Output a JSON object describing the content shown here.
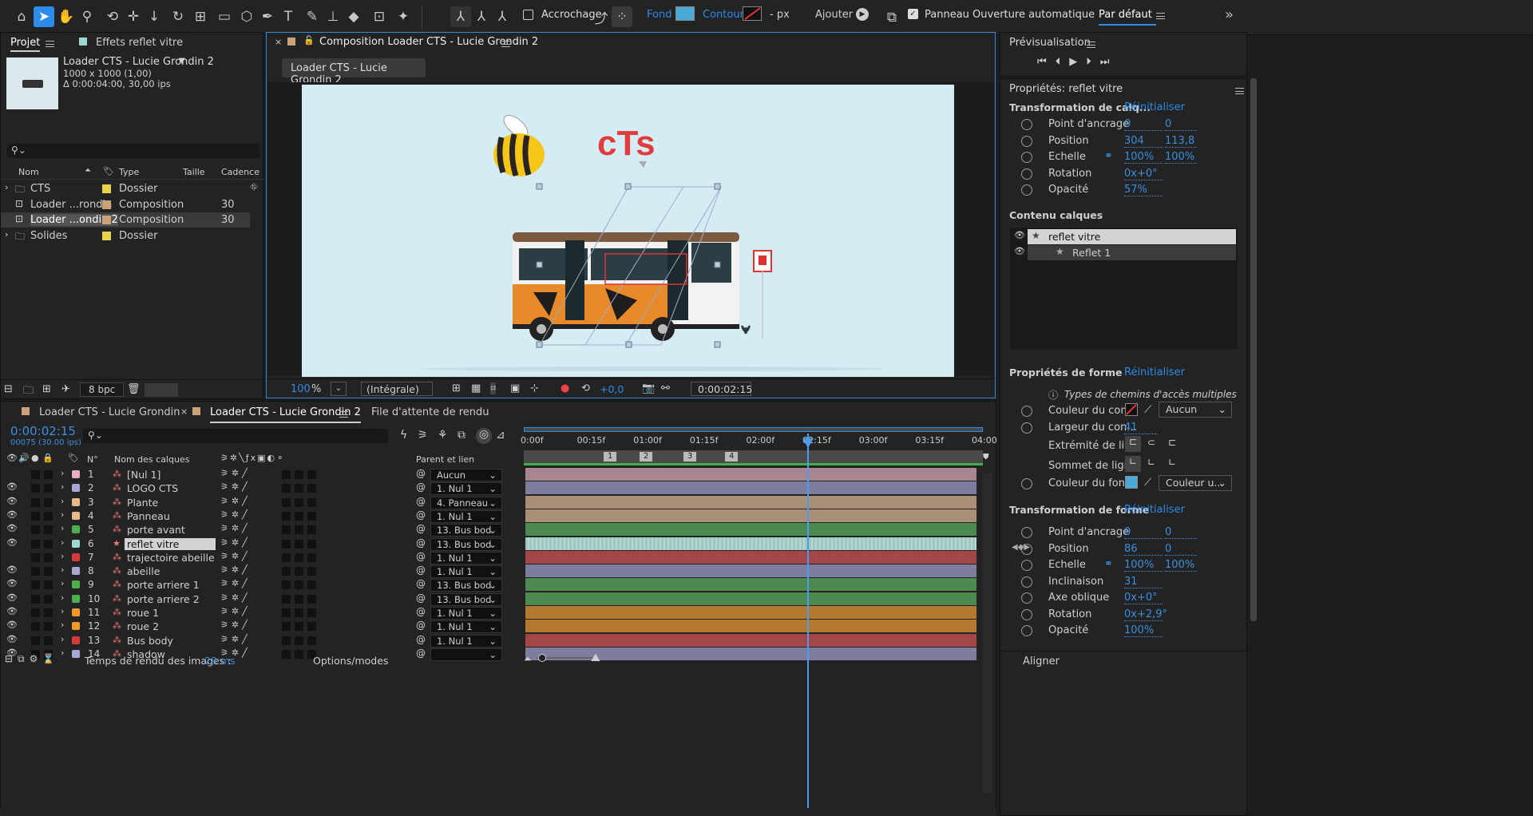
{
  "toolbar": {
    "snap_label": "Accrochage",
    "fill_label": "Fond :",
    "stroke_label": "Contour :",
    "stroke_unit": "- px",
    "add_label": "Ajouter :",
    "auto_open_label": "Panneau Ouverture automatique",
    "workspace": "Par défaut"
  },
  "project": {
    "tab_label": "Projet",
    "effects_tab": "Effets reflet vitre",
    "comp_name": "Loader CTS - Lucie Grondin 2",
    "comp_size": "1000 x 1000 (1,00)",
    "comp_duration": "Δ 0:00:04:00, 30,00 ips",
    "search_placeholder": "",
    "columns": [
      "Nom",
      "Type",
      "Taille",
      "Cadence"
    ],
    "items": [
      {
        "name": "CTS",
        "type": "Dossier",
        "cadence": "",
        "color": "#e8d34c"
      },
      {
        "name": "Loader ...rondin",
        "type": "Composition",
        "cadence": "30",
        "color": "#c9a27a"
      },
      {
        "name": "Loader ...ondin 2",
        "type": "Composition",
        "cadence": "30",
        "color": "#c9a27a"
      },
      {
        "name": "Solides",
        "type": "Dossier",
        "cadence": "",
        "color": "#e8d34c"
      }
    ],
    "bpc": "8 bpc"
  },
  "composition": {
    "tab_title": "Composition Loader CTS - Lucie Grondin 2",
    "sub_tab": "Loader CTS - Lucie Grondin 2",
    "logo_text": "cTs",
    "zoom": "100",
    "zoom_unit": "%",
    "resolution": "(Intégrale)",
    "exposure": "+0,0",
    "timecode": "0:00:02:15"
  },
  "timeline": {
    "tabs": [
      "Loader CTS - Lucie Grondin",
      "Loader CTS - Lucie Grondin 2",
      "File d'attente de rendu"
    ],
    "timecode": "0:00:02:15",
    "fps_info": "00075 (30.00 ips)",
    "col_num": "N°",
    "col_name": "Nom des calques",
    "col_parent": "Parent et lien",
    "ruler": [
      "0:00f",
      "00:15f",
      "01:00f",
      "01:15f",
      "02:00f",
      "02:15f",
      "03:00f",
      "03:15f",
      "04:00"
    ],
    "markers": [
      "1",
      "2",
      "3",
      "4"
    ],
    "layers": [
      {
        "num": "1",
        "name": "[Nul 1]",
        "parent": "Aucun",
        "color": "#e6b0c0",
        "bar": "#a98590"
      },
      {
        "num": "2",
        "name": "LOGO CTS",
        "parent": "1. Nul 1",
        "color": "#a9a7d8",
        "bar": "#7e7d9d"
      },
      {
        "num": "3",
        "name": "Plante",
        "parent": "4. Panneau",
        "color": "#e8b98a",
        "bar": "#a98f76"
      },
      {
        "num": "4",
        "name": "Panneau",
        "parent": "1. Nul 1",
        "color": "#e8b98a",
        "bar": "#a98f76"
      },
      {
        "num": "5",
        "name": "porte avant",
        "parent": "13. Bus bod",
        "color": "#4caf50",
        "bar": "#4c8a52"
      },
      {
        "num": "6",
        "name": "reflet vitre",
        "parent": "13. Bus bod",
        "color": "#9ed8d0",
        "bar": "#9fc7c2"
      },
      {
        "num": "7",
        "name": "trajectoire abeille",
        "parent": "1. Nul 1",
        "color": "#d63a3a",
        "bar": "#a34648"
      },
      {
        "num": "8",
        "name": "abeille",
        "parent": "1. Nul 1",
        "color": "#a9a7d8",
        "bar": "#7e7d9d"
      },
      {
        "num": "9",
        "name": "porte arriere 1",
        "parent": "13. Bus bod",
        "color": "#4caf50",
        "bar": "#4c8a52"
      },
      {
        "num": "10",
        "name": "porte arriere 2",
        "parent": "13. Bus bod",
        "color": "#4caf50",
        "bar": "#4c8a52"
      },
      {
        "num": "11",
        "name": "roue 1",
        "parent": "1. Nul 1",
        "color": "#f09a2a",
        "bar": "#b2792f"
      },
      {
        "num": "12",
        "name": "roue 2",
        "parent": "1. Nul 1",
        "color": "#f09a2a",
        "bar": "#b2792f"
      },
      {
        "num": "13",
        "name": "Bus body",
        "parent": "1. Nul 1",
        "color": "#d63a3a",
        "bar": "#a34648"
      },
      {
        "num": "14",
        "name": "shadow",
        "parent": "",
        "color": "#a9a7d8",
        "bar": "#7e7d9d"
      }
    ],
    "render_time_label": "Temps de rendu des images :",
    "render_time": "23 ms",
    "options": "Options/modes"
  },
  "preview": {
    "title": "Prévisualisation"
  },
  "properties": {
    "title": "Propriétés: reflet vitre",
    "layer_transform": "Transformation de calq...",
    "reset": "Réinitialiser",
    "layer_props": [
      {
        "label": "Point d'ancrage",
        "v1": "0",
        "v2": "0"
      },
      {
        "label": "Position",
        "v1": "304",
        "v2": "113,8"
      },
      {
        "label": "Echelle",
        "v1": "100%",
        "v2": "100%"
      },
      {
        "label": "Rotation",
        "v1": "0x+0°",
        "v2": ""
      },
      {
        "label": "Opacité",
        "v1": "57%",
        "v2": ""
      }
    ],
    "content_title": "Contenu calques",
    "content_items": [
      "reflet vitre",
      "Reflet 1"
    ],
    "shape_props_title": "Propriétés de forme",
    "shape_reset": "Réinitialiser",
    "path_types": "Types de chemins d'accès multiples",
    "stroke_color_label": "Couleur du con...",
    "stroke_color_value": "Aucun",
    "stroke_width_label": "Largeur du con...",
    "stroke_width": "41",
    "line_cap_label": "Extrémité de li...",
    "line_join_label": "Sommet de ligne",
    "fill_color_label": "Couleur du fond",
    "fill_color_value": "Couleur u...",
    "shape_transform": "Transformation de forme",
    "shape_transform_reset": "Réinitialiser",
    "shape_props": [
      {
        "label": "Point d'ancrage",
        "v1": "0",
        "v2": "0"
      },
      {
        "label": "Position",
        "v1": "86",
        "v2": "0"
      },
      {
        "label": "Echelle",
        "v1": "100%",
        "v2": "100%"
      },
      {
        "label": "Inclinaison",
        "v1": "31",
        "v2": ""
      },
      {
        "label": "Axe oblique",
        "v1": "0x+0°",
        "v2": ""
      },
      {
        "label": "Rotation",
        "v1": "0x+2,9°",
        "v2": ""
      },
      {
        "label": "Opacité",
        "v1": "100%",
        "v2": ""
      }
    ],
    "align": "Aligner"
  }
}
